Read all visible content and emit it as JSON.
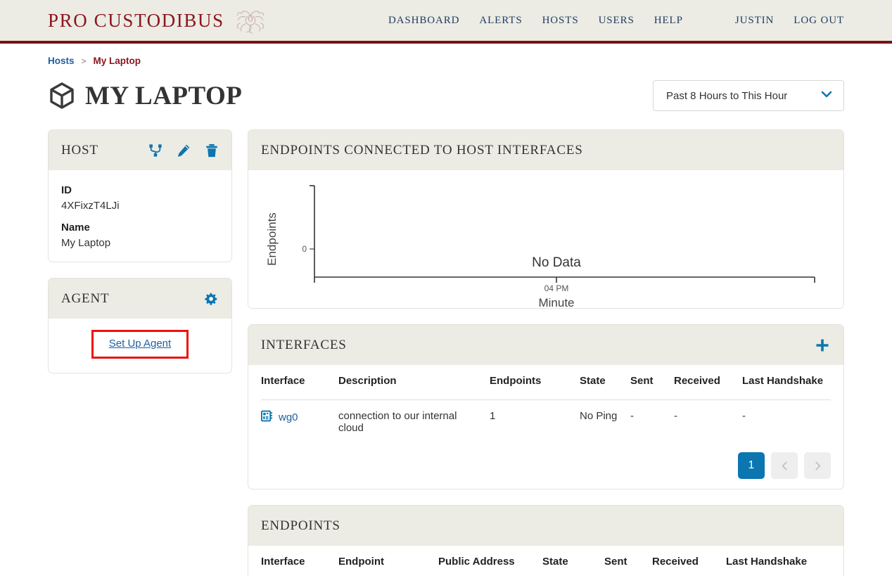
{
  "brand": {
    "name": "PRO CUSTODIBUS",
    "logo_icon": "medusa-logo-icon"
  },
  "nav": {
    "items": [
      {
        "label": "DASHBOARD",
        "name": "nav-dashboard"
      },
      {
        "label": "ALERTS",
        "name": "nav-alerts"
      },
      {
        "label": "HOSTS",
        "name": "nav-hosts"
      },
      {
        "label": "USERS",
        "name": "nav-users"
      },
      {
        "label": "HELP",
        "name": "nav-help"
      }
    ],
    "user": "JUSTIN",
    "logout": "LOG OUT"
  },
  "breadcrumb": {
    "parent": "Hosts",
    "separator": ">",
    "current": "My Laptop"
  },
  "page": {
    "title": "MY LAPTOP",
    "title_icon": "cube-icon"
  },
  "range_selector": {
    "value": "Past 8 Hours to This Hour",
    "icon": "chevron-down-icon"
  },
  "host_card": {
    "title": "HOST",
    "icons": [
      {
        "name": "network-topology-icon"
      },
      {
        "name": "edit-pencil-icon"
      },
      {
        "name": "trash-delete-icon"
      }
    ],
    "fields": [
      {
        "label": "ID",
        "value": "4XFixzT4LJi"
      },
      {
        "label": "Name",
        "value": "My Laptop"
      }
    ]
  },
  "agent_card": {
    "title": "AGENT",
    "gear_icon": "gear-icon",
    "link_label": "Set Up Agent",
    "highlight_color": "#ee1111"
  },
  "chart_card": {
    "title": "ENDPOINTS CONNECTED TO HOST INTERFACES"
  },
  "chart_data": {
    "type": "line",
    "title": "Endpoints Connected to Host Interfaces",
    "xlabel": "Minute",
    "ylabel": "Endpoints",
    "empty_message": "No Data",
    "x_ticks": [
      "04 PM"
    ],
    "y_ticks": [
      "0"
    ],
    "ylim": [
      0,
      1
    ],
    "series": [
      {
        "name": "Endpoints",
        "values": []
      }
    ],
    "grid": false,
    "legend": "none"
  },
  "interfaces_card": {
    "title": "INTERFACES",
    "add_icon": "plus-add-icon",
    "columns": [
      "Interface",
      "Description",
      "Endpoints",
      "State",
      "Sent",
      "Received",
      "Last Handshake"
    ],
    "rows": [
      {
        "interface": "wg0",
        "interface_icon": "network-interface-icon",
        "description": "connection to our internal cloud",
        "endpoints": "1",
        "state": "No Ping",
        "state_color": "#e23b34",
        "sent": "-",
        "received": "-",
        "last_handshake": "-"
      }
    ],
    "pagination": {
      "current": "1",
      "prev_icon": "chevron-left-icon",
      "next_icon": "chevron-right-icon"
    }
  },
  "endpoints_card": {
    "title": "ENDPOINTS",
    "columns": [
      "Interface",
      "Endpoint",
      "Public Address",
      "State",
      "Sent",
      "Received",
      "Last Handshake"
    ]
  },
  "colors": {
    "brand_red": "#8d1620",
    "header_bar": "#7b1113",
    "accent_blue": "#0b76b0",
    "link_blue": "#1f5fa0",
    "card_head": "#ecece4",
    "danger": "#e23b34"
  }
}
